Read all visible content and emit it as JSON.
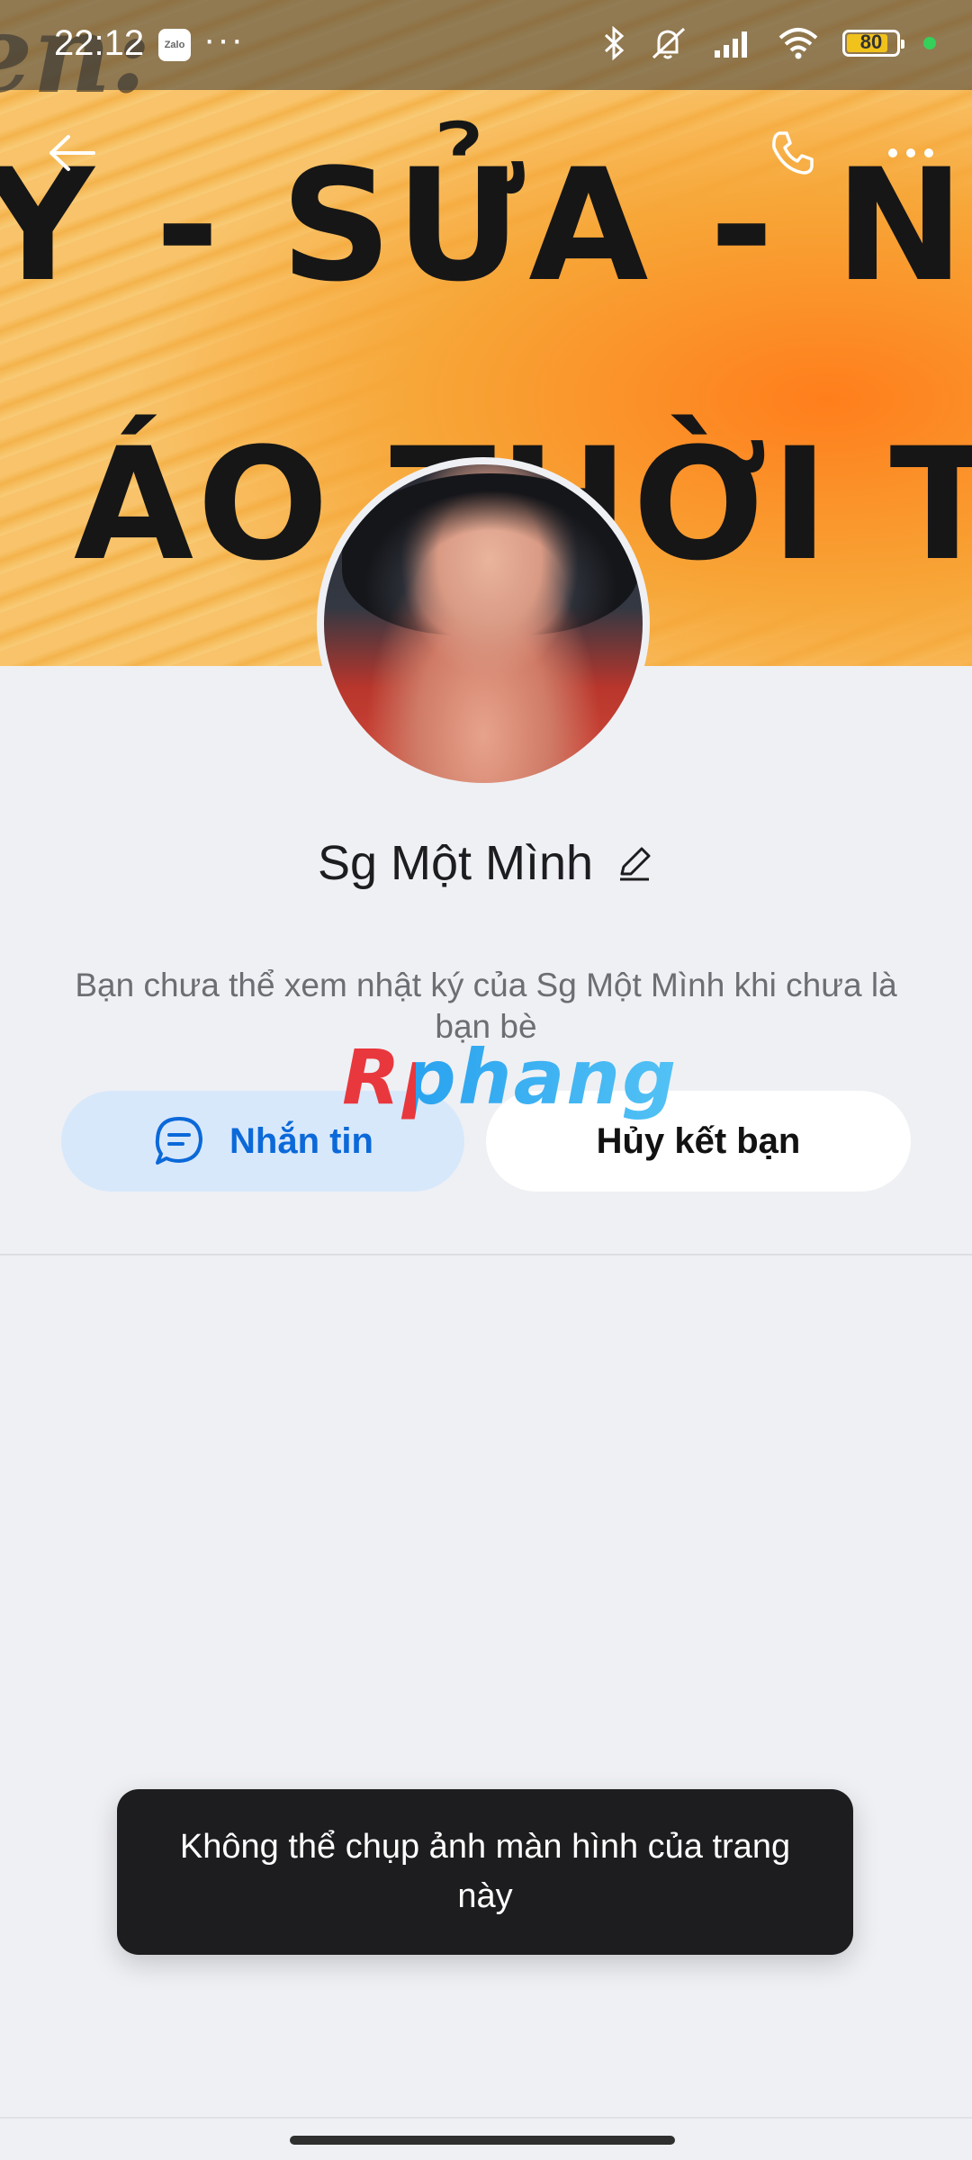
{
  "status_bar": {
    "time": "22:12",
    "app_badge": "Zalo",
    "overflow": "···",
    "battery": "80",
    "battery_color": "#f1c21b",
    "dot_color": "#35d05a"
  },
  "cover": {
    "line1": "Y - SỬA - NHƯ",
    "line2": "I ÁO THỜI T",
    "partial": "en:"
  },
  "profile": {
    "name": "Sg Một Mình",
    "info": "Bạn chưa thể xem nhật ký của Sg Một Mình khi chưa là bạn bè"
  },
  "watermark": "Rphang",
  "actions": {
    "message_label": "Nhắn tin",
    "unfriend_label": "Hủy kết bạn",
    "accent": "#0b69d9"
  },
  "toast": {
    "text": "Không thể chụp ảnh màn hình của trang này"
  },
  "icons": {
    "back": "arrow-left-icon",
    "call": "phone-icon",
    "more": "more-icon",
    "edit": "pencil-icon",
    "chat": "chat-bubble-icon"
  }
}
